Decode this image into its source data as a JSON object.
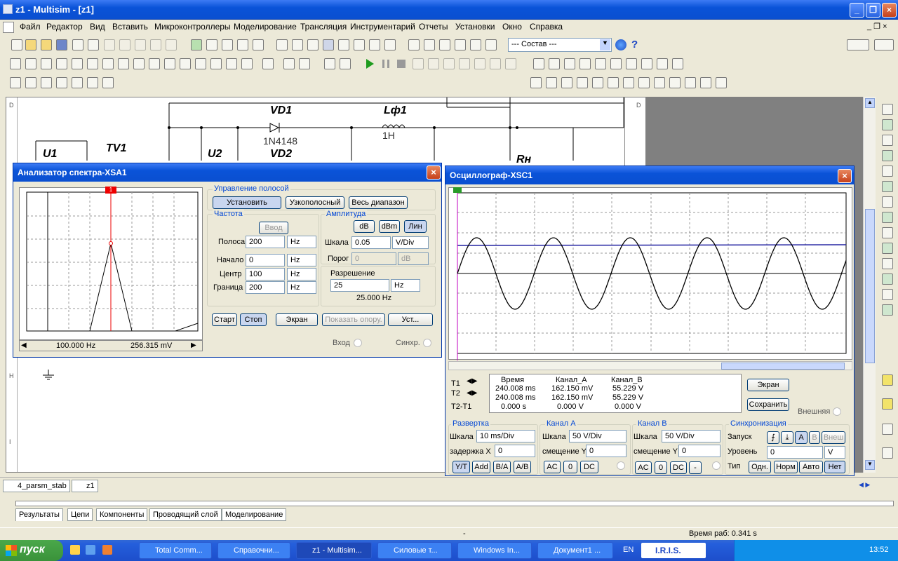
{
  "window": {
    "title": "z1 - Multisim - [z1]"
  },
  "menu": [
    "Файл",
    "Редактор",
    "Вид",
    "Вставить",
    "Микроконтроллеры",
    "Моделирование",
    "Трансляция",
    "Инструментарий",
    "Отчеты",
    "Установки",
    "Окно",
    "Справка"
  ],
  "toolbar": {
    "combo": "--- Состав ---",
    "help": "?"
  },
  "schematic": {
    "labels": {
      "vd1": "VD1",
      "lf1": "Lф1",
      "d1n": "1N4148",
      "h1": "1H",
      "u1": "U1",
      "tv1": "TV1",
      "u2": "U2",
      "vd2": "VD2",
      "rn": "Rн"
    },
    "ruler": {
      "left_d": "D",
      "right_d": "D",
      "left_h": "H",
      "left_i": "I"
    }
  },
  "spectrum": {
    "title": "Анализатор спектра-XSA1",
    "marker": "1",
    "freq_readout": "100.000  Hz",
    "amp_readout": "256.315 mV",
    "band_group": "Управление полосой",
    "btn_set": "Установить",
    "btn_narrow": "Узкополосный",
    "btn_full": "Весь диапазон",
    "freq_group": "Частота",
    "btn_input": "Ввод",
    "band_label": "Полоса",
    "band_val": "200",
    "band_unit": "Hz",
    "start_label": "Начало",
    "start_val": "0",
    "start_unit": "Hz",
    "center_label": "Центр",
    "center_val": "100",
    "center_unit": "Hz",
    "end_label": "Граница",
    "end_val": "200",
    "end_unit": "Hz",
    "amp_group": "Амплитуда",
    "btn_db": "dB",
    "btn_dbm": "dBm",
    "btn_lin": "Лин",
    "scale_label": "Шкала",
    "scale_val": "0.05",
    "scale_unit": "V/Div",
    "thresh_label": "Порог",
    "thresh_val": "0",
    "thresh_unit": "dB",
    "res_group": "Разрешение",
    "res_val": "25",
    "res_unit": "Hz",
    "res_text": "25.000  Hz",
    "btn_start": "Старт",
    "btn_stop": "Стоп",
    "btn_screen": "Экран",
    "btn_ref": "Показать опору.",
    "btn_set2": "Уст...",
    "input_label": "Вход",
    "sync_label": "Синхр."
  },
  "scope": {
    "title": "Осциллограф-XSC1",
    "t1": "T1",
    "t2": "T2",
    "t21": "T2-T1",
    "h_time": "Время",
    "h_a": "Канал_A",
    "h_b": "Канал_B",
    "r1": [
      "240.008 ms",
      "162.150 mV",
      "55.229 V"
    ],
    "r2": [
      "240.008 ms",
      "162.150 mV",
      "55.229 V"
    ],
    "r3": [
      "0.000 s",
      "0.000 V",
      "0.000 V"
    ],
    "btn_screen": "Экран",
    "btn_save": "Сохранить",
    "ext_label": "Внешняя",
    "sweep_group": "Развертка",
    "sweep_scale_label": "Шкала",
    "sweep_scale": "10 ms/Div",
    "sweep_delay_label": "задержка X",
    "sweep_delay": "0",
    "btn_yt": "Y/T",
    "btn_add": "Add",
    "btn_ba": "B/A",
    "btn_ab": "A/B",
    "cha_group": "Канал А",
    "cha_scale_label": "Шкала",
    "cha_scale": "50  V/Div",
    "cha_off_label": "смещение Y",
    "cha_off": "0",
    "chb_group": "Канал В",
    "chb_scale_label": "Шкала",
    "chb_scale": "50  V/Div",
    "chb_off_label": "смещение Y",
    "chb_off": "0",
    "btn_ac": "AC",
    "btn_0": "0",
    "btn_dc": "DC",
    "btn_minus": "-",
    "sync_group": "Синхронизация",
    "trig_label": "Запуск",
    "btn_a": "A",
    "btn_b": "B",
    "btn_ext": "Внеш",
    "level_label": "Уровень",
    "level_val": "0",
    "level_unit": "V",
    "type_label": "Тип",
    "btn_single": "Одн.",
    "btn_norm": "Норм",
    "btn_auto": "Авто",
    "btn_none": "Нет"
  },
  "sheettabs": [
    "4_parsm_stab",
    "z1"
  ],
  "bottomtabs": [
    "Результаты",
    "Цепи",
    "Компоненты",
    "Проводящий слой",
    "Моделирование"
  ],
  "status": {
    "dash": "-",
    "runtime": "Время раб: 0.341 s"
  },
  "taskbar": {
    "start": "пуск",
    "tasks": [
      "Total Comm...",
      "Справочни...",
      "z1 - Multisim...",
      "Силовые т...",
      "Windows In...",
      "Документ1 ..."
    ],
    "lang": "EN",
    "iris": "I.R.I.S.",
    "clock": "13:52"
  }
}
